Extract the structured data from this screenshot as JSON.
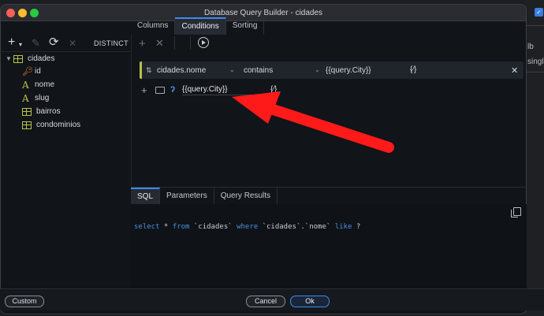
{
  "window": {
    "title": "Database Query Builder - cidades"
  },
  "top_tabs": [
    {
      "label": "Columns"
    },
    {
      "label": "Conditions",
      "active": true
    },
    {
      "label": "Sorting"
    }
  ],
  "toolbar": {
    "distinct_label": "DISTINCT"
  },
  "tree": {
    "root": "cidades",
    "columns": [
      {
        "label": "id",
        "icon": "key-icon"
      },
      {
        "label": "nome",
        "icon": "text-icon"
      },
      {
        "label": "slug",
        "icon": "text-icon"
      }
    ],
    "tables": [
      {
        "label": "bairros"
      },
      {
        "label": "condominios"
      }
    ]
  },
  "condition": {
    "field": "cidades.nome",
    "operator": "contains",
    "value": "{{query.City}}",
    "expr_icon": "{⁄}"
  },
  "sub_condition": {
    "value": "{{query.City}}",
    "expr_icon": "{⁄}"
  },
  "bottom_tabs": [
    {
      "label": "SQL",
      "active": true
    },
    {
      "label": "Parameters"
    },
    {
      "label": "Query Results"
    }
  ],
  "sql": {
    "kw1": "select",
    "t1": " * ",
    "kw2": "from",
    "t2": " `cidades` ",
    "kw3": "where",
    "t3": " `cidades`.`nome` ",
    "kw4": "like",
    "t4": " ?"
  },
  "footer": {
    "custom_label": "Custom",
    "cancel_label": "Cancel",
    "ok_label": "Ok"
  },
  "background_app": {
    "text1": "lb",
    "text2": "single"
  },
  "colors": {
    "accent": "#3b8bf0",
    "table_icon": "#b6c24a",
    "key_icon": "#e47c3a",
    "arrow": "#ff1a1a"
  }
}
